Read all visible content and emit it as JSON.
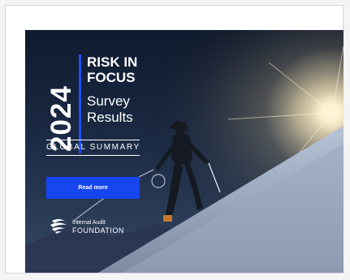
{
  "cover": {
    "year": "2024",
    "title_bold_line1": "RISK IN",
    "title_bold_line2": "FOCUS",
    "title_light_line1": "Survey",
    "title_light_line2": "Results",
    "subtitle": "GLOBAL SUMMARY",
    "read_more_label": "Read more",
    "org_line1": "Internal Audit",
    "org_line2": "FOUNDATION"
  },
  "colors": {
    "accent_blue": "#1746f0",
    "bar_blue": "#1f4fff",
    "text": "#ffffff"
  },
  "icons": {
    "logo": "foundation-logo-icon"
  }
}
